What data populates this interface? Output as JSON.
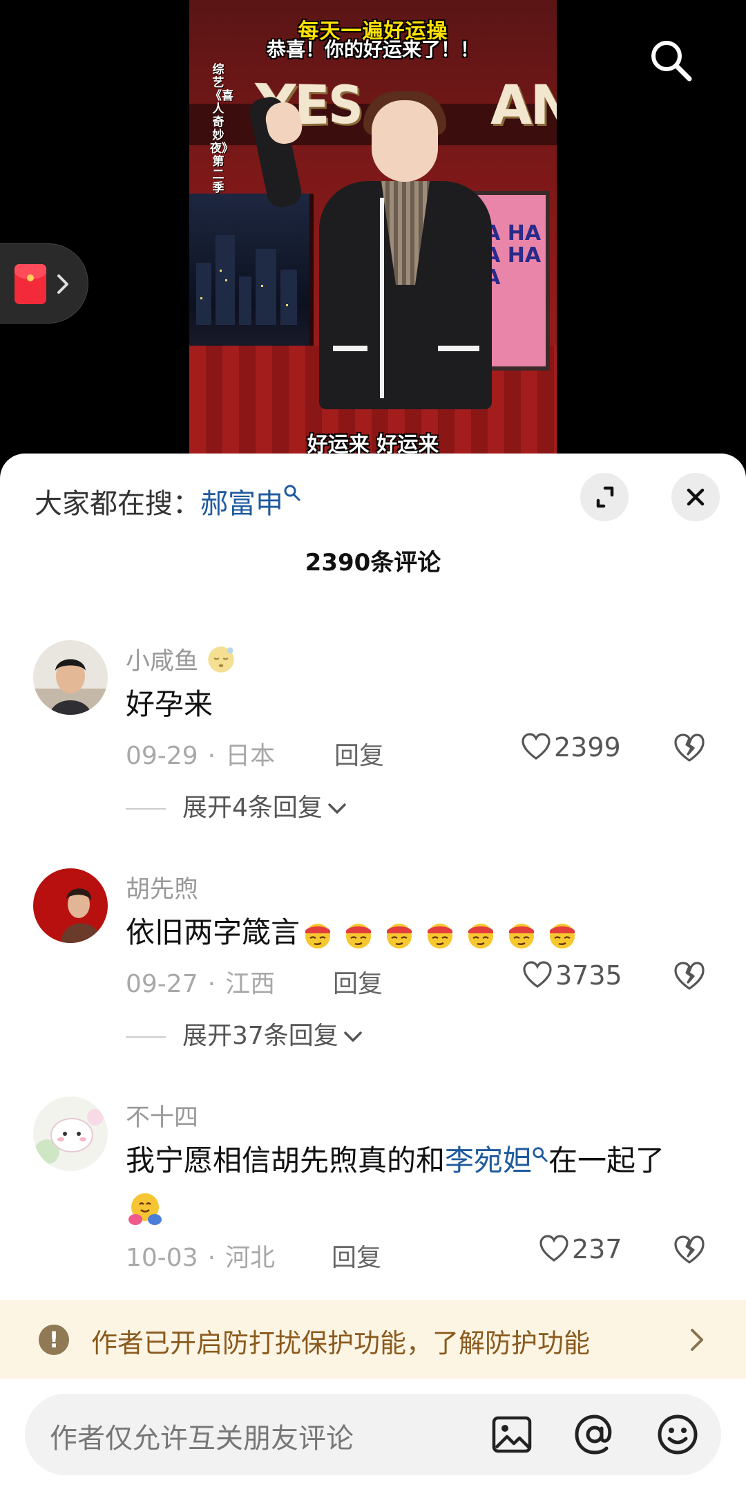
{
  "video": {
    "title_line1": "每天一遍好运操",
    "title_line2": "恭喜！你的好运来了！！",
    "side_caption": "综艺《喜人奇妙夜》第二季",
    "subtitle": "好运来 好运来",
    "sign_left": "YES",
    "sign_right": "AN",
    "poster_text": "HA HA HA HA HA"
  },
  "sheet": {
    "hot_search_prefix": "大家都在搜：",
    "hot_search_term": "郝富申",
    "comment_count": "2390条评论"
  },
  "comments": [
    {
      "name": "小咸鱼",
      "text": "好孕来",
      "date": "09-29",
      "location": "日本",
      "reply": "回复",
      "likes": "2399",
      "expand": "展开4条回复"
    },
    {
      "name": "胡先煦",
      "text": "依旧两字箴言",
      "emoji_count": 7,
      "date": "09-27",
      "location": "江西",
      "reply": "回复",
      "likes": "3735",
      "expand": "展开37条回复"
    },
    {
      "name": "不十四",
      "text_before": "我宁愿相信胡先煦真的和",
      "text_link": "李宛妲",
      "text_after": "在一起了",
      "date": "10-03",
      "location": "河北",
      "reply": "回复",
      "likes": "237"
    }
  ],
  "notice": {
    "text": "作者已开启防打扰保护功能，了解防护功能"
  },
  "input": {
    "placeholder": "作者仅允许互关朋友评论"
  },
  "colors": {
    "link": "#1e5a9e",
    "notice_bg": "#fdf5e4",
    "notice_text": "#8a5a1e",
    "subtitle_yellow": "#ffe200"
  },
  "icons": [
    "search-icon",
    "red-packet-icon",
    "expand-icon",
    "close-icon",
    "heart-icon",
    "dislike-icon",
    "chevron-down-icon",
    "warning-icon",
    "chevron-right-icon",
    "image-icon",
    "at-icon",
    "emoji-icon"
  ]
}
